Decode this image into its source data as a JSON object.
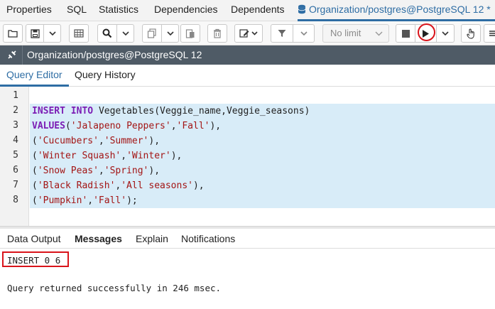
{
  "top_tabs": [
    {
      "label": "Properties"
    },
    {
      "label": "SQL"
    },
    {
      "label": "Statistics"
    },
    {
      "label": "Dependencies"
    },
    {
      "label": "Dependents"
    },
    {
      "label": "Organization/postgres@PostgreSQL 12 *",
      "active": true
    }
  ],
  "toolbar": {
    "limit_value": "No limit",
    "icons": [
      "folder-open-icon",
      "save-icon",
      "chevron-down-icon",
      "grid-icon",
      "search-icon",
      "chevron-down-icon",
      "copy-icon",
      "chevron-down-icon",
      "paste-icon",
      "delete-icon",
      "edit-icon",
      "chevron-down-icon",
      "filter-icon",
      "chevron-down-icon",
      "stop-icon",
      "execute-icon",
      "chevron-down-icon",
      "pointer-icon",
      "menu-icon"
    ]
  },
  "connection": {
    "title": "Organization/postgres@PostgreSQL 12"
  },
  "editor_tabs": [
    {
      "label": "Query Editor",
      "active": true
    },
    {
      "label": "Query History"
    }
  ],
  "editor": {
    "line_numbers": [
      "1",
      "2",
      "3",
      "4",
      "5",
      "6",
      "7",
      "8"
    ],
    "lines": [
      "",
      "INSERT INTO Vegetables(Veggie_name,Veggie_seasons)",
      "VALUES('Jalapeno Peppers','Fall'),",
      "('Cucumbers','Summer'),",
      "('Winter Squash','Winter'),",
      "('Snow Peas','Spring'),",
      "('Black Radish','All seasons'),",
      "('Pumpkin','Fall');"
    ]
  },
  "output_tabs": [
    {
      "label": "Data Output"
    },
    {
      "label": "Messages",
      "active": true
    },
    {
      "label": "Explain"
    },
    {
      "label": "Notifications"
    }
  ],
  "messages": {
    "result": "INSERT 0 6",
    "status": "Query returned successfully in 246 msec."
  },
  "colors": {
    "accent": "#2e6da4",
    "connection_bar": "#4f5b66",
    "keyword": "#7c1eb5",
    "string": "#a31515",
    "selection": "#d8ecf8",
    "annotation": "#d9141b"
  }
}
